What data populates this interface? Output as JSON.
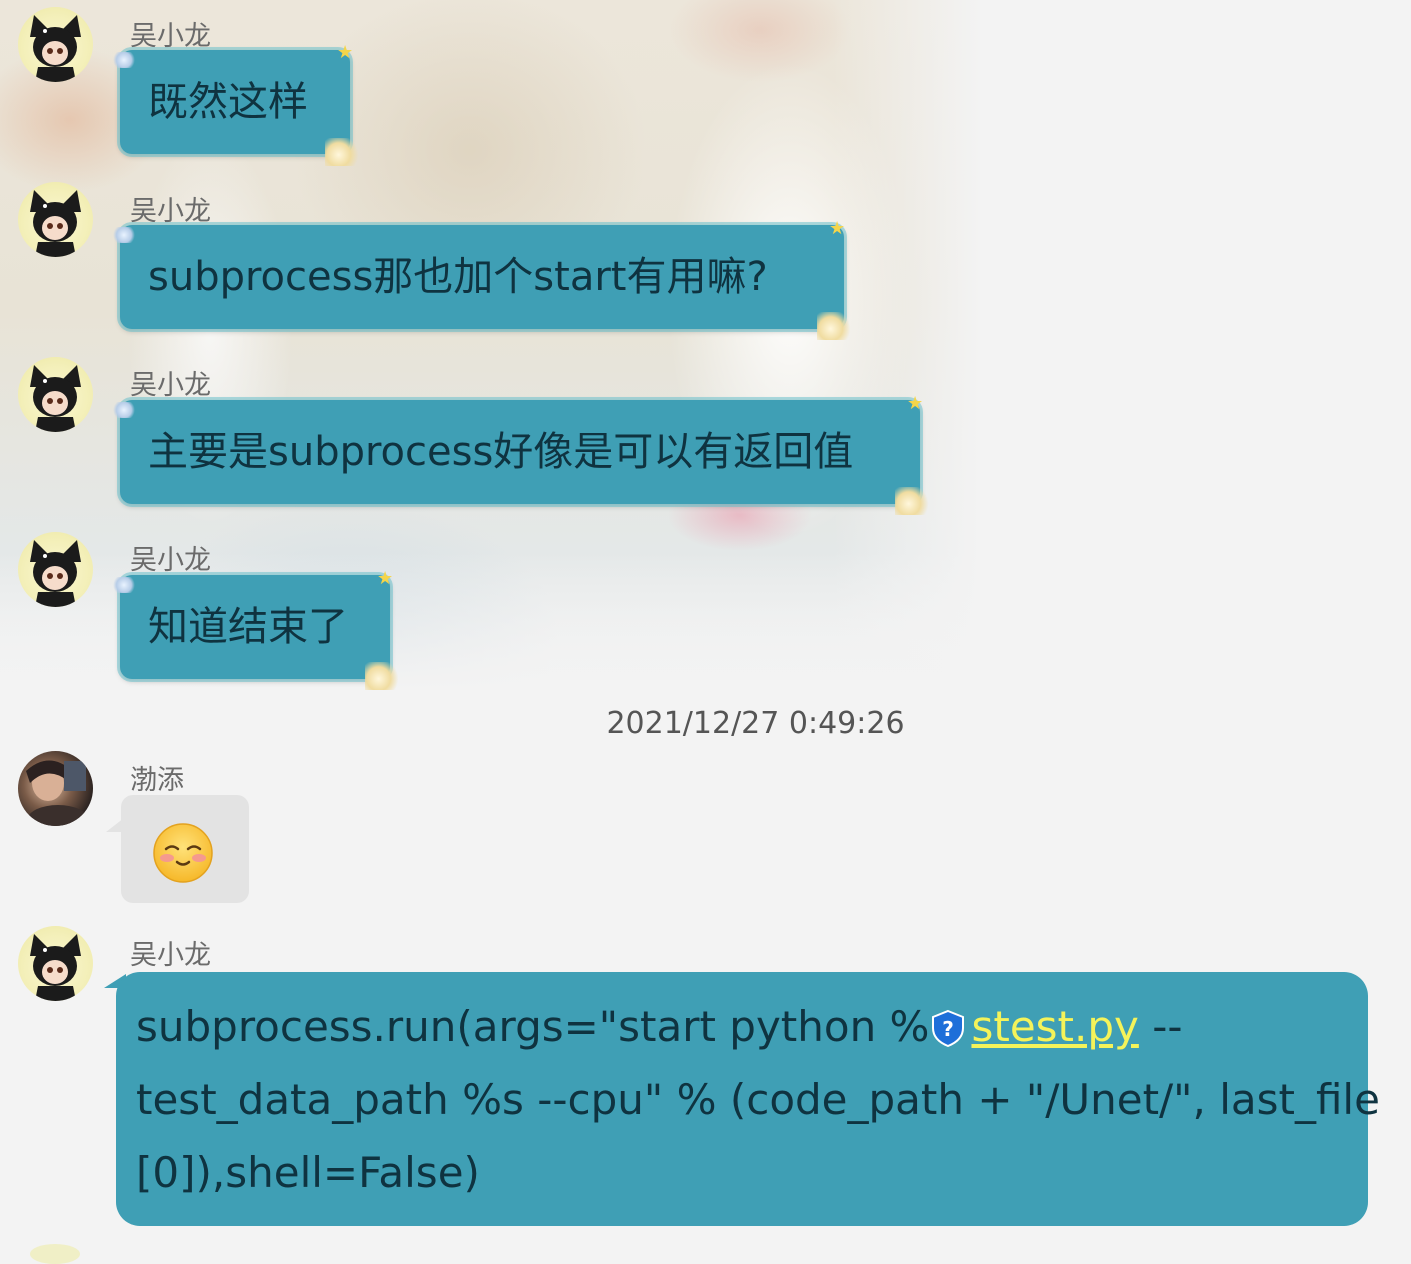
{
  "messages": [
    {
      "sender": "吴小龙",
      "text": "既然这样"
    },
    {
      "sender": "吴小龙",
      "text": "subprocess那也加个start有用嘛?"
    },
    {
      "sender": "吴小龙",
      "text": "主要是subprocess好像是可以有返回值"
    },
    {
      "sender": "吴小龙",
      "text": "知道结束了"
    }
  ],
  "timestamp": "2021/12/27 0:49:26",
  "emoji_message": {
    "sender": "渤添",
    "emoji": "smiling-blush-emoji"
  },
  "code_message": {
    "sender": "吴小龙",
    "line1_prefix": "subprocess.run(args=\"start python %",
    "link": "stest.py",
    "line1_suffix": " --",
    "line2": "test_data_path %s --cpu\" % (code_path + \"/Unet/\", last_file",
    "line3": "[0]),shell=False)"
  },
  "colors": {
    "bubble": "#3f9fb5",
    "bubble_text": "#0f3340",
    "link": "#f4f35a",
    "gray_bubble": "#e3e3e3",
    "background": "#f3f3f3"
  },
  "icons": {
    "cat_avatar": "cat-girl-avatar",
    "person_avatar": "person-photo-avatar",
    "link_badge": "shield-question-icon"
  }
}
